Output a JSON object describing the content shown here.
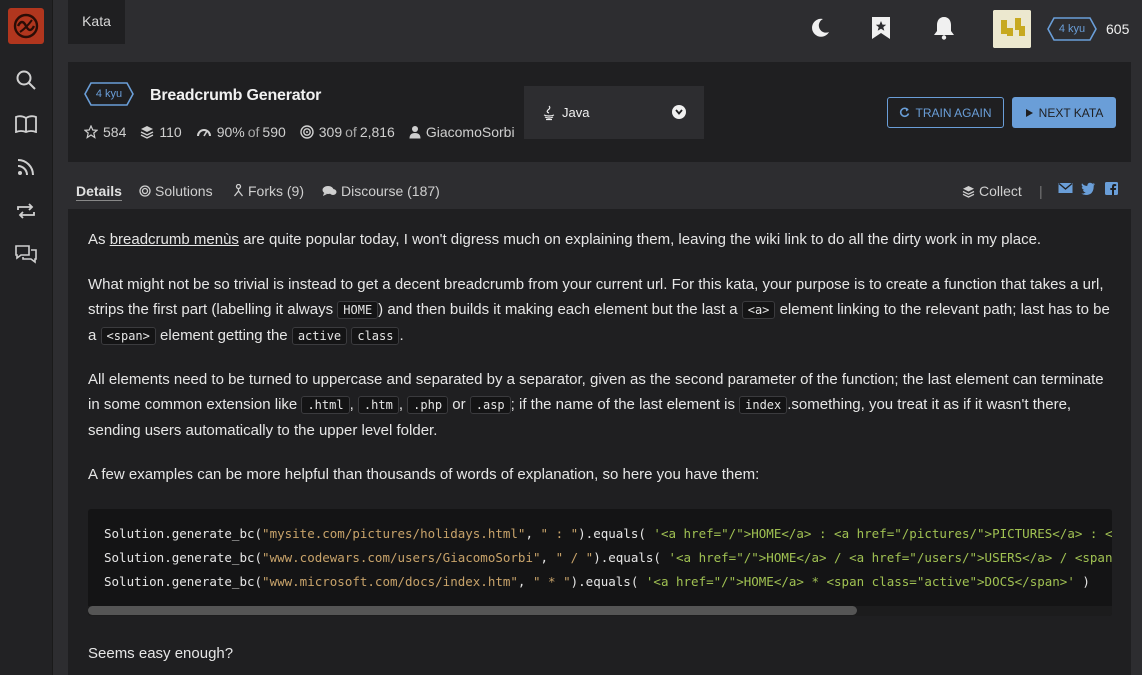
{
  "topbar": {
    "kata_tab": "Kata",
    "rank": "4 kyu",
    "honor": "605"
  },
  "kata": {
    "rank": "4 kyu",
    "title": "Breadcrumb Generator",
    "stars": "584",
    "collections": "110",
    "satisfaction": "90%",
    "satisfaction_of": "of",
    "satisfaction_votes": "590",
    "completed": "309",
    "completed_of": "of",
    "attempts": "2,816",
    "author": "GiacomoSorbi",
    "language": "Java",
    "train_again": "TRAIN AGAIN",
    "next_kata": "NEXT KATA"
  },
  "tabs": {
    "details": "Details",
    "solutions": "Solutions",
    "forks": "Forks (9)",
    "discourse": "Discourse (187)",
    "collect": "Collect",
    "separator": "|"
  },
  "description": {
    "p1_link": "breadcrumb menùs",
    "p1_start": "As",
    "p1_end": "are quite popular today, I won't digress much on explaining them, leaving the wiki link to do all the dirty work in my place.",
    "p2_a": "What might not be so trivial is instead to get a decent breadcrumb from your current url. For this kata, your purpose is to create a function that takes a url, strips the first part (labelling it always",
    "p2_code1": "HOME",
    "p2_b": ") and then builds it making each element but the last a",
    "p2_code2": "<a>",
    "p2_c": "element linking to the relevant path; last has to be a",
    "p2_code3": "<span>",
    "p2_d": "element getting the",
    "p2_code4": "active",
    "p2_code5": "class",
    "p2_e": ".",
    "p3_a": "All elements need to be turned to uppercase and separated by a separator, given as the second parameter of the function; the last element can terminate in some common extension like",
    "p3_code1": ".html",
    "p3_sep1": ",",
    "p3_code2": ".htm",
    "p3_sep2": ",",
    "p3_code3": ".php",
    "p3_or": "or",
    "p3_code4": ".asp",
    "p3_b": "; if the name of the last element is",
    "p3_code5": "index",
    "p3_c": ".something, you treat it as if it wasn't there, sending users automatically to the upper level folder.",
    "p4": "A few examples can be more helpful than thousands of words of explanation, so here you have them:",
    "p5": "Seems easy enough?"
  },
  "code": {
    "line1_a": "Solution.generate_bc(",
    "line1_s1": "\"mysite.com/pictures/holidays.html\"",
    "line1_b": ", ",
    "line1_s2": "\" : \"",
    "line1_c": ").equals( ",
    "line1_s3": "'<a href=\"/\">HOME</a> : <a href=\"/pictures/\">PICTURES</a> : <span class=\"active\">HOLIDAYS</span>'",
    "line1_d": " )",
    "line2_a": "Solution.generate_bc(",
    "line2_s1": "\"www.codewars.com/users/GiacomoSorbi\"",
    "line2_b": ", ",
    "line2_s2": "\" / \"",
    "line2_c": ").equals( ",
    "line2_s3": "'<a href=\"/\">HOME</a> / <a href=\"/users/\">USERS</a> / <span class=\"active\">GIACOMOSORBI</span>'",
    "line2_d": " )",
    "line3_a": "Solution.generate_bc(",
    "line3_s1": "\"www.microsoft.com/docs/index.htm\"",
    "line3_b": ", ",
    "line3_s2": "\" * \"",
    "line3_c": ").equals( ",
    "line3_s3": "'<a href=\"/\">HOME</a> * <span class=\"active\">DOCS</span>'",
    "line3_d": " )"
  },
  "colors": {
    "accent": "#6a9ed8",
    "logo": "#b1361e",
    "string_orange": "#c8a36a",
    "string_green": "#a0c152"
  },
  "icons": [
    "logo-icon",
    "search-icon",
    "book-icon",
    "rss-icon",
    "repeat-icon",
    "chat-icon",
    "moon-icon",
    "bookmark-star-icon",
    "bell-icon",
    "star-icon",
    "layers-icon",
    "gauge-icon",
    "target-icon",
    "user-icon",
    "java-icon",
    "chevron-down-icon",
    "refresh-icon",
    "play-icon",
    "fork-icon",
    "comments-icon",
    "email-icon",
    "twitter-icon",
    "facebook-icon"
  ]
}
